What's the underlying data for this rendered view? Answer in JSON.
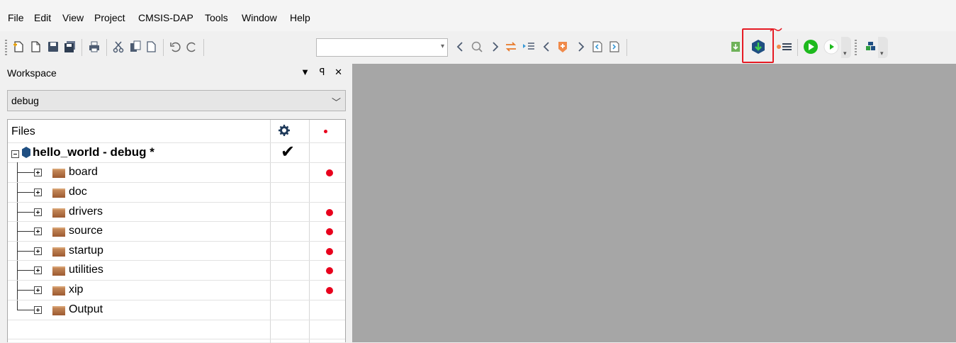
{
  "menu": [
    "File",
    "Edit",
    "View",
    "Project",
    "CMSIS-DAP",
    "Tools",
    "Window",
    "Help"
  ],
  "toolbar": {
    "find_combo_value": "",
    "icons": [
      "new-file-icon",
      "open-file-icon",
      "save-icon",
      "save-all-icon",
      "print-icon",
      "cut-icon",
      "copy-icon",
      "paste-icon",
      "undo-icon",
      "redo-icon",
      "find-previous-icon",
      "find-icon",
      "find-next-icon",
      "replace-icon",
      "go-to-icon",
      "bookmark-prev-icon",
      "toggle-bookmark-icon",
      "bookmark-next-icon",
      "navigate-back-icon",
      "navigate-forward-icon",
      "make-icon",
      "download-and-debug-icon",
      "breakpoint-icon",
      "debug-icon",
      "run-icon",
      "project-connection-icon"
    ],
    "highlight_color": "#e51b24"
  },
  "workspace": {
    "title": "Workspace",
    "pin_glyph": "▼ ꟼ ✕",
    "configuration": "debug",
    "columns": {
      "files": "Files",
      "options_icon": "gear-icon",
      "breakpoint_icon": "red-dot-icon"
    },
    "project": {
      "name": "hello_world - debug *",
      "check": "✔"
    },
    "groups": [
      {
        "name": "board",
        "has_dot": true
      },
      {
        "name": "doc",
        "has_dot": false
      },
      {
        "name": "drivers",
        "has_dot": true
      },
      {
        "name": "source",
        "has_dot": true
      },
      {
        "name": "startup",
        "has_dot": true
      },
      {
        "name": "utilities",
        "has_dot": true
      },
      {
        "name": "xip",
        "has_dot": true
      },
      {
        "name": "Output",
        "has_dot": false
      }
    ]
  },
  "colors": {
    "editor_bg": "#a6a6a6",
    "dot": "#e8001c",
    "run_green": "#1db91d",
    "debug_green": "#2f9e3e",
    "project_blue": "#1f4f82"
  }
}
